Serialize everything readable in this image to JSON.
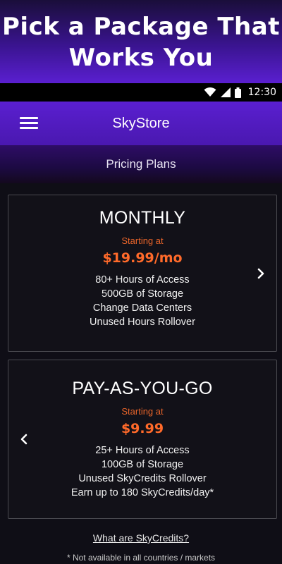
{
  "promo": {
    "title_line1": "Pick a Package That",
    "title_line2": "Works You"
  },
  "status_bar": {
    "time": "12:30",
    "icons": [
      "wifi-icon",
      "cellular-signal-icon",
      "battery-icon"
    ]
  },
  "app_bar": {
    "title": "SkyStore",
    "menu_icon": "hamburger-menu-icon"
  },
  "sub_header": {
    "title": "Pricing Plans"
  },
  "plans": [
    {
      "name": "MONTHLY",
      "starting_label": "Starting at",
      "price": "$19.99/mo",
      "features": [
        "80+ Hours of Access",
        "500GB of Storage",
        "Change Data Centers",
        "Unused Hours Rollover"
      ],
      "nav_icon": "chevron-right-icon"
    },
    {
      "name": "PAY-AS-YOU-GO",
      "starting_label": "Starting at",
      "price": "$9.99",
      "features": [
        "25+ Hours of Access",
        "100GB of Storage",
        "Unused SkyCredits Rollover",
        "Earn up to 180 SkyCredits/day*"
      ],
      "nav_icon": "chevron-left-icon"
    }
  ],
  "footer": {
    "link_text": "What are SkyCredits?",
    "footnote": "* Not available in all countries / markets"
  },
  "colors": {
    "accent_purple": "#5a1fd0",
    "price_orange": "#ff6a2a",
    "background": "#0f0e16"
  }
}
